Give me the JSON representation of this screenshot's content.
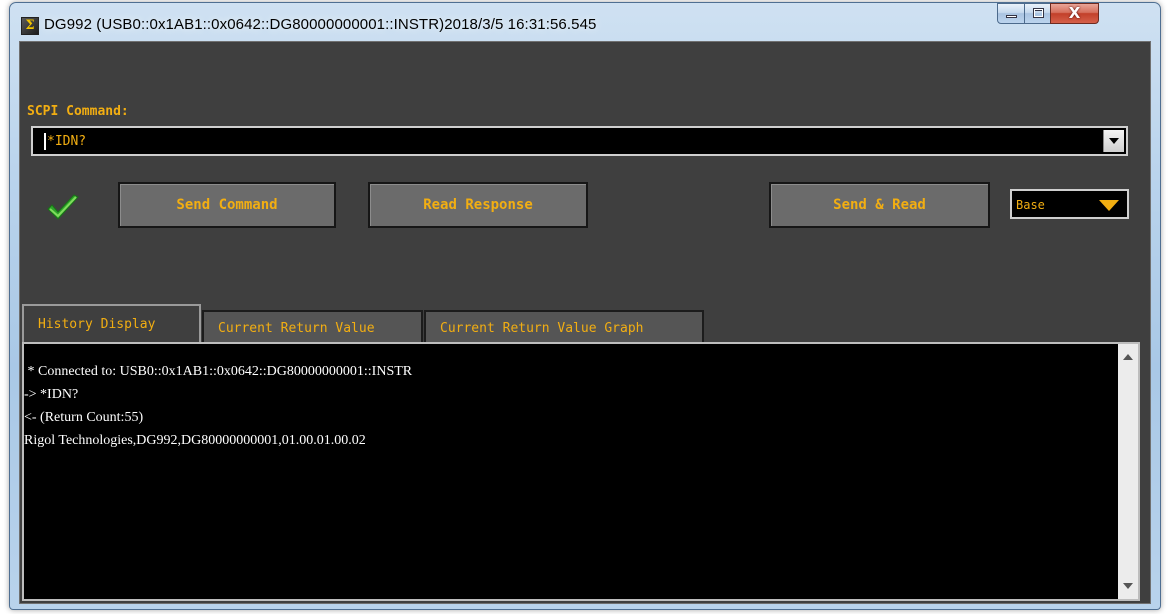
{
  "window": {
    "title": "DG992 (USB0::0x1AB1::0x0642::DG80000000001::INSTR)2018/3/5 16:31:56.545",
    "app_icon_glyph": "Σ",
    "close_glyph": "X"
  },
  "command": {
    "label": "SCPI Command:",
    "value": "*IDN?"
  },
  "status": {
    "icon": "check-icon",
    "color": "#2ea52a"
  },
  "buttons": {
    "send": "Send Command",
    "read": "Read Response",
    "send_read": "Send & Read"
  },
  "base_select": {
    "value": "Base"
  },
  "tabs": [
    {
      "label": "History Display",
      "active": true
    },
    {
      "label": "Current Return Value",
      "active": false
    },
    {
      "label": "Current Return Value Graph",
      "active": false
    }
  ],
  "history": {
    "lines": [
      " * Connected to: USB0::0x1AB1::0x0642::DG80000000001::INSTR",
      "-> *IDN?",
      "<- (Return Count:55)",
      "Rigol Technologies,DG992,DG80000000001,01.00.01.00.02"
    ]
  },
  "colors": {
    "accent_text": "#f2ae12",
    "panel_bg": "#3f3f3f",
    "button_bg": "#6b6b6b",
    "history_text": "#ffffff"
  }
}
